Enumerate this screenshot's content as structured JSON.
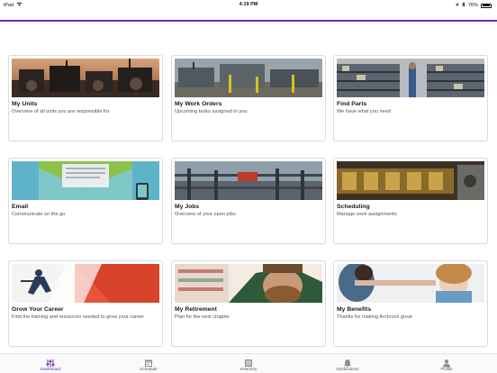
{
  "status_bar": {
    "device": "iPad",
    "time": "4:19 PM",
    "battery": "76%"
  },
  "cards": [
    {
      "title": "My Units",
      "subtitle": "Overview of all units you are responsible for",
      "image": "compressor-units-photo"
    },
    {
      "title": "My Work Orders",
      "subtitle": "Upcoming tasks assigned to you",
      "image": "industrial-site-photo"
    },
    {
      "title": "Find Parts",
      "subtitle": "We have what you need",
      "image": "warehouse-shelves-photo"
    },
    {
      "title": "Email",
      "subtitle": "Communicate on the go",
      "image": "envelope-illustration"
    },
    {
      "title": "My Jobs",
      "subtitle": "Overview of your open jobs",
      "image": "pipes-facility-photo"
    },
    {
      "title": "Scheduling",
      "subtitle": "Manage work assignments",
      "image": "engine-machinery-photo"
    },
    {
      "title": "Grow Your Career",
      "subtitle": "Find the training and resources needed to grow your career",
      "image": "running-man-illustration"
    },
    {
      "title": "My Retirement",
      "subtitle": "Plan for the next chapter",
      "image": "bearded-man-photo"
    },
    {
      "title": "My Benefits",
      "subtitle": "Thanks for making Archrock great",
      "image": "child-doctor-photo"
    }
  ],
  "tabs": [
    {
      "label": "Dashboard",
      "icon": "sliders-icon",
      "active": true
    },
    {
      "label": "Schedule",
      "icon": "calendar-icon",
      "active": false
    },
    {
      "label": "Inventory",
      "icon": "inventory-icon",
      "active": false
    },
    {
      "label": "Notifications",
      "icon": "bell-icon",
      "active": false
    },
    {
      "label": "Profile",
      "icon": "person-icon",
      "active": false
    }
  ],
  "colors": {
    "accent": "#6a2bb3",
    "card_border": "#dcdcdc"
  }
}
